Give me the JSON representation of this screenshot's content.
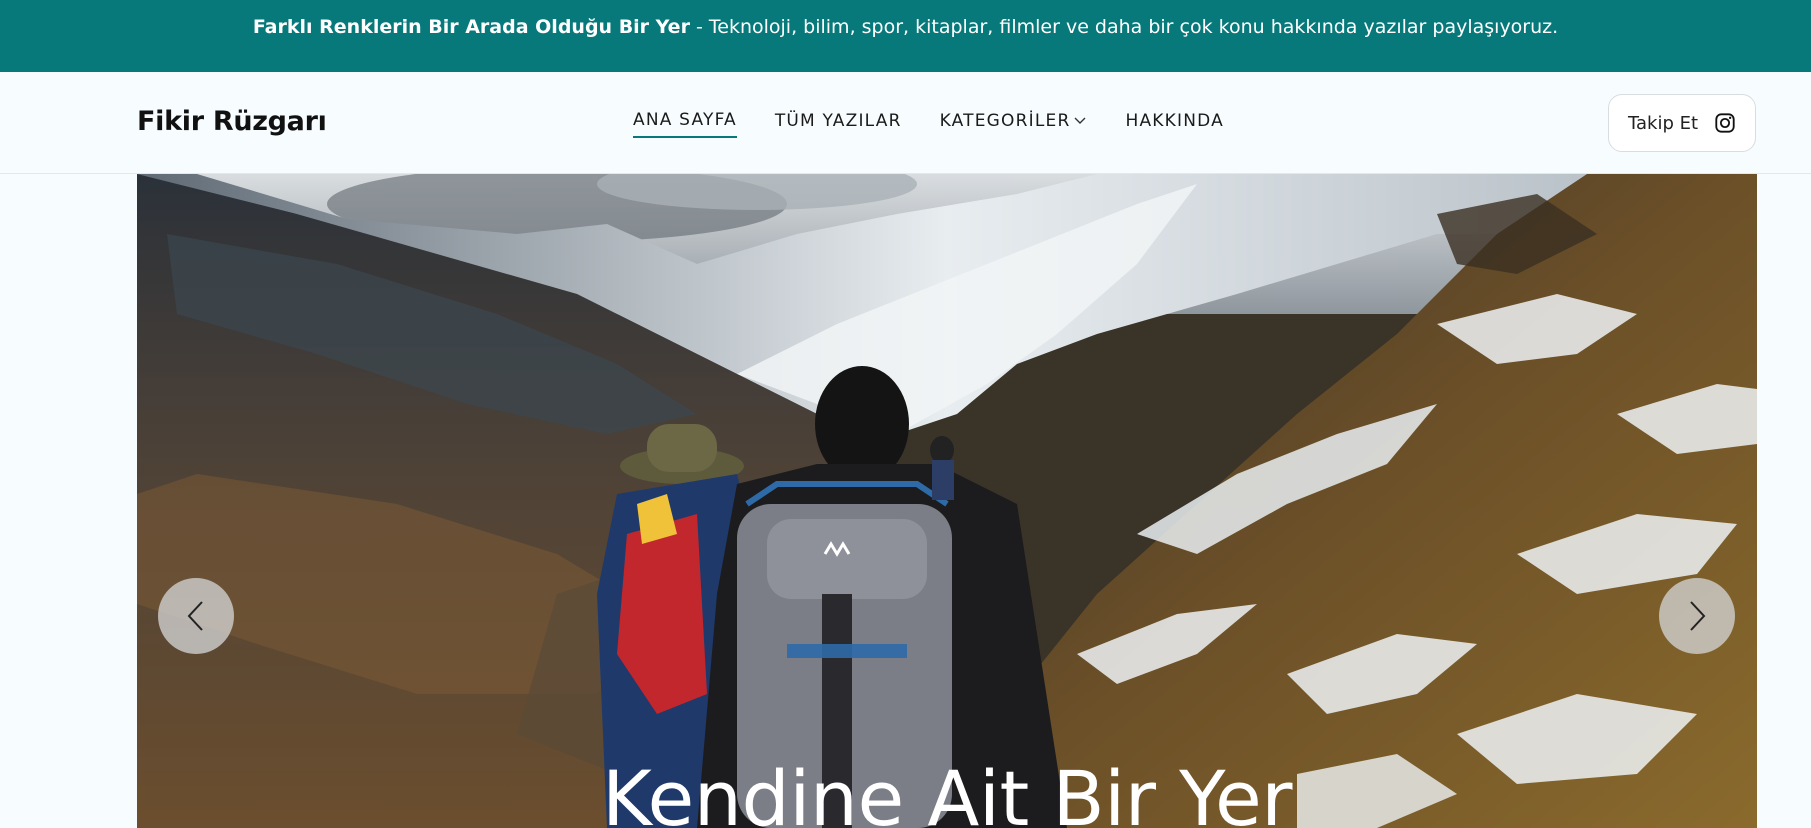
{
  "announcement": {
    "bold": "Farklı Renklerin Bir Arada Olduğu Bir Yer",
    "text": " - Teknoloji, bilim, spor, kitaplar, filmler ve daha bir çok konu hakkında yazılar paylaşıyoruz."
  },
  "header": {
    "brand": "Fikir Rüzgarı",
    "nav": [
      {
        "label": "ANA SAYFA",
        "active": true
      },
      {
        "label": "TÜM YAZILAR"
      },
      {
        "label": "KATEGORİLER",
        "dropdown": true
      },
      {
        "label": "HAKKINDA"
      }
    ],
    "follow_label": "Takip Et",
    "follow_icon": "instagram-icon"
  },
  "hero": {
    "title": "Kendine Ait Bir Yer",
    "image": "mountain-hikers-photo",
    "prev_icon": "chevron-left-icon",
    "next_icon": "chevron-right-icon"
  },
  "colors": {
    "accent": "#07797a",
    "page_bg": "#f7fcfe"
  }
}
